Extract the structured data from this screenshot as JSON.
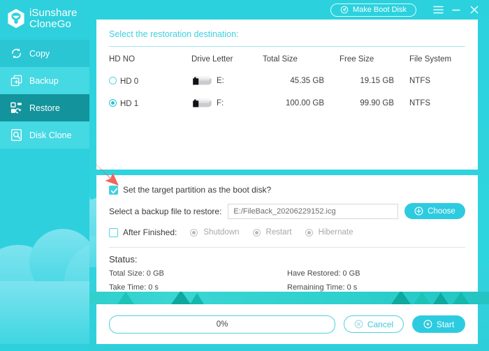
{
  "app": {
    "brand_line1": "iSunshare",
    "brand_line2": "CloneGo",
    "logo_icon": "shield-hexagon-icon",
    "accent": "#2dcbe0",
    "accent_dark": "#13939b",
    "sidebar_bg": "#2ed0dd",
    "title_color": "#3fd0e0"
  },
  "titlebar": {
    "boot_disk_label": "Make Boot Disk",
    "boot_disk_icon": "disc-icon",
    "menu_icon": "hamburger-menu-icon",
    "minimize_icon": "minimize-icon",
    "close_icon": "close-icon"
  },
  "sidebar": {
    "items": [
      {
        "label": "Copy",
        "icon": "refresh-circle-icon",
        "active": false
      },
      {
        "label": "Backup",
        "icon": "plus-square-stack-icon",
        "active": false
      },
      {
        "label": "Restore",
        "icon": "restore-blocks-icon",
        "active": true
      },
      {
        "label": "Disk Clone",
        "icon": "disk-search-icon",
        "active": false
      }
    ]
  },
  "destination": {
    "title": "Select the restoration destination:",
    "columns": [
      "HD NO",
      "Drive Letter",
      "Total Size",
      "Free Size",
      "File System"
    ],
    "rows": [
      {
        "hd_no": "HD 0",
        "selected": false,
        "drive_letter": "E:",
        "drive_icon": "hard-drive-icon",
        "total_size": "45.35 GB",
        "free_size": "19.15 GB",
        "file_system": "NTFS"
      },
      {
        "hd_no": "HD 1",
        "selected": true,
        "drive_letter": "F:",
        "drive_icon": "hard-drive-icon",
        "total_size": "100.00 GB",
        "free_size": "99.90 GB",
        "file_system": "NTFS"
      }
    ]
  },
  "options": {
    "boot_disk_checkbox_label": "Set the target partition as the boot disk?",
    "boot_disk_checked": true,
    "backup_file_label": "Select a backup file to restore:",
    "backup_file_value": "E:/FileBack_20206229152.icg",
    "backup_file_placeholder": "",
    "choose_label": "Choose",
    "choose_icon": "plus-circle-icon",
    "after_finished_label": "After Finished:",
    "after_finished_checked": false,
    "after_finished_options": [
      {
        "label": "Shutdown",
        "selected": false,
        "disabled": true
      },
      {
        "label": "Restart",
        "selected": false,
        "disabled": true
      },
      {
        "label": "Hibernate",
        "selected": false,
        "disabled": true
      }
    ]
  },
  "status": {
    "title": "Status:",
    "left": [
      "Total Size: 0 GB",
      "Take Time: 0 s"
    ],
    "right": [
      "Have Restored: 0 GB",
      "Remaining Time: 0 s"
    ]
  },
  "footer": {
    "progress_text": "0%",
    "progress_percent": 0,
    "cancel_label": "Cancel",
    "cancel_icon": "cancel-circle-icon",
    "start_label": "Start",
    "start_icon": "play-circle-icon"
  },
  "annotation": {
    "arrow_icon": "red-arrow-pointer",
    "arrow_color": "#f2655b"
  }
}
